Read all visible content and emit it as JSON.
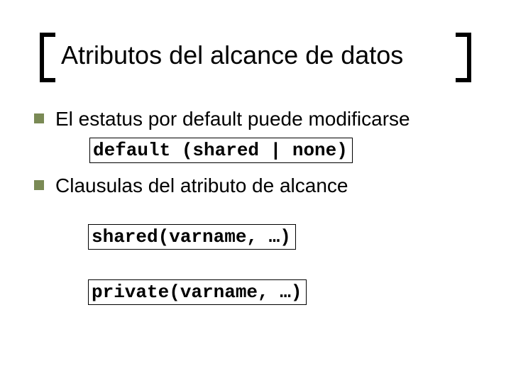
{
  "title": "Atributos del alcance de datos",
  "bullets": [
    {
      "text": "El estatus por default puede modificarse"
    },
    {
      "text": "Clausulas del atributo de alcance"
    }
  ],
  "code": {
    "default_clause": "default (shared | none)",
    "shared_clause": "shared(varname, …)",
    "private_clause": "private(varname, …)"
  },
  "colors": {
    "bullet": "#7a8a55"
  }
}
